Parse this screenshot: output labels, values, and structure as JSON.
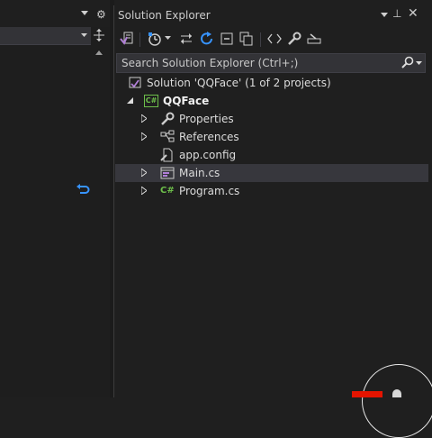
{
  "colors": {
    "accent_blue": "#3794ff",
    "csharp_green": "#6dbf4a",
    "selected_row": "#37373d",
    "overlay_red": "#e51400"
  },
  "left_pane": {
    "top_bar_icons": [
      "chevron-down-icon",
      "gear-icon"
    ],
    "combo_icons": [
      "chevron-down-icon"
    ],
    "split_icon": "split-view-icon",
    "scroll_icon": "scroll-up-icon",
    "glyph_icon": "return-arrow-icon"
  },
  "solution_explorer": {
    "title": "Solution Explorer",
    "title_icons": [
      "chevron-down-icon",
      "pin-icon",
      "close-icon"
    ],
    "toolbar_icons": [
      "switch-views-icon",
      "history-icon",
      "chevron-down-icon",
      "sync-icon",
      "refresh-icon",
      "collapse-all-icon",
      "show-all-files-icon",
      "view-code-icon",
      "properties-icon",
      "preview-icon"
    ],
    "search": {
      "placeholder": "Search Solution Explorer (Ctrl+;)",
      "value": "",
      "icons": [
        "search-icon",
        "chevron-down-icon"
      ]
    },
    "tree": {
      "solution_label": "Solution 'QQFace' (1 of 2 projects)",
      "project_label": "QQFace",
      "project_icon_text": "C#",
      "items": [
        {
          "label": "Properties",
          "icon": "wrench-icon"
        },
        {
          "label": "References",
          "icon": "references-icon"
        },
        {
          "label": "app.config",
          "icon": "config-file-icon"
        },
        {
          "label": "Main.cs",
          "icon": "form-icon",
          "selected": true
        },
        {
          "label": "Program.cs",
          "icon": "csharp-file-icon",
          "icon_text": "C#"
        }
      ]
    }
  }
}
